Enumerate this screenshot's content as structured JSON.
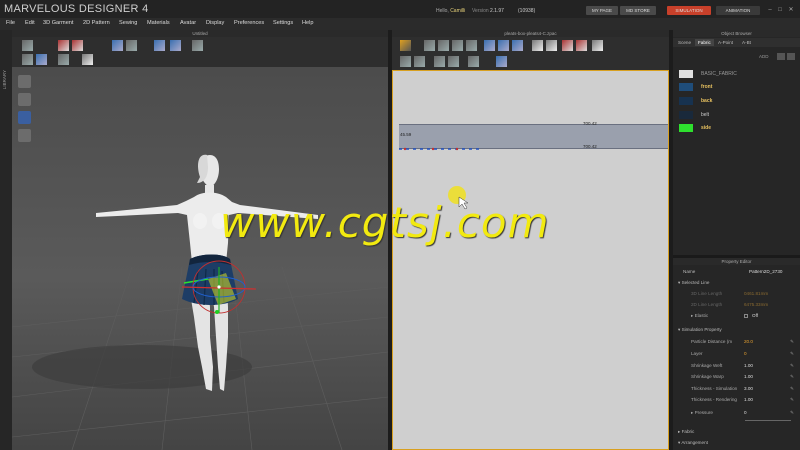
{
  "titlebar": {
    "app_title": "MARVELOUS DESIGNER 4",
    "hello_prefix": "Hello,",
    "user": "Camilli",
    "version_label": "Version",
    "version": "2.1.97",
    "build": "(10938)",
    "my_page": "MY PAGE",
    "md_store": "MD STORE",
    "simulation": "SIMULATION",
    "animation": "ANIMATION"
  },
  "menu": [
    "File",
    "Edit",
    "3D Garment",
    "2D Pattern",
    "Sewing",
    "Materials",
    "Avatar",
    "Display",
    "Preferences",
    "Settings",
    "Help"
  ],
  "library_tab": "LIBRARY",
  "viewport3d": {
    "title": "Untitled"
  },
  "viewport2d": {
    "title": "pleats-box-pleats4-C.zpac",
    "meas_top": "700.42",
    "meas_left": "45.59",
    "meas_bottom": "700.42"
  },
  "object_browser": {
    "title": "Object Browser",
    "tabs": [
      "Scene",
      "Fabric",
      "A-Point",
      "A-Bt"
    ],
    "add_label": "ADD",
    "fabrics": [
      {
        "name": "BASIC_FABRIC",
        "color": "#e0e0e0"
      },
      {
        "name": "front",
        "color": "#1f4d7a"
      },
      {
        "name": "back",
        "color": "#17324f"
      },
      {
        "name": "belt",
        "color": "#19293b"
      },
      {
        "name": "side",
        "color": "#2ee02e"
      }
    ]
  },
  "property_editor": {
    "title": "Property Editor",
    "name_label": "Name",
    "name_value": "Pattern2D_2730",
    "selected_line": "Selected Line",
    "line_length_3d_label": "3D Line Length",
    "line_length_3d": "0461.81mm",
    "line_length_2d_label": "2D Line Length",
    "line_length_2d": "6475.33mm",
    "elastic_label": "Elastic",
    "elastic_value": "Off",
    "sim_property": "Simulation Property",
    "rows": [
      {
        "label": "Particle Distance (m",
        "value": "20.0"
      },
      {
        "label": "Layer",
        "value": "0"
      },
      {
        "label": "Shrinkage Weft",
        "value": "1.00"
      },
      {
        "label": "Shrinkage Warp",
        "value": "1.00"
      },
      {
        "label": "Thickness - Simulation",
        "value": "3.00"
      },
      {
        "label": "Thickness - Rendering",
        "value": "1.00"
      }
    ],
    "pressure_label": "Pressure",
    "pressure_value": "0",
    "fabric_section": "Fabric",
    "arrangement_section": "Arrangement"
  },
  "watermark": "www.cgtsj.com"
}
